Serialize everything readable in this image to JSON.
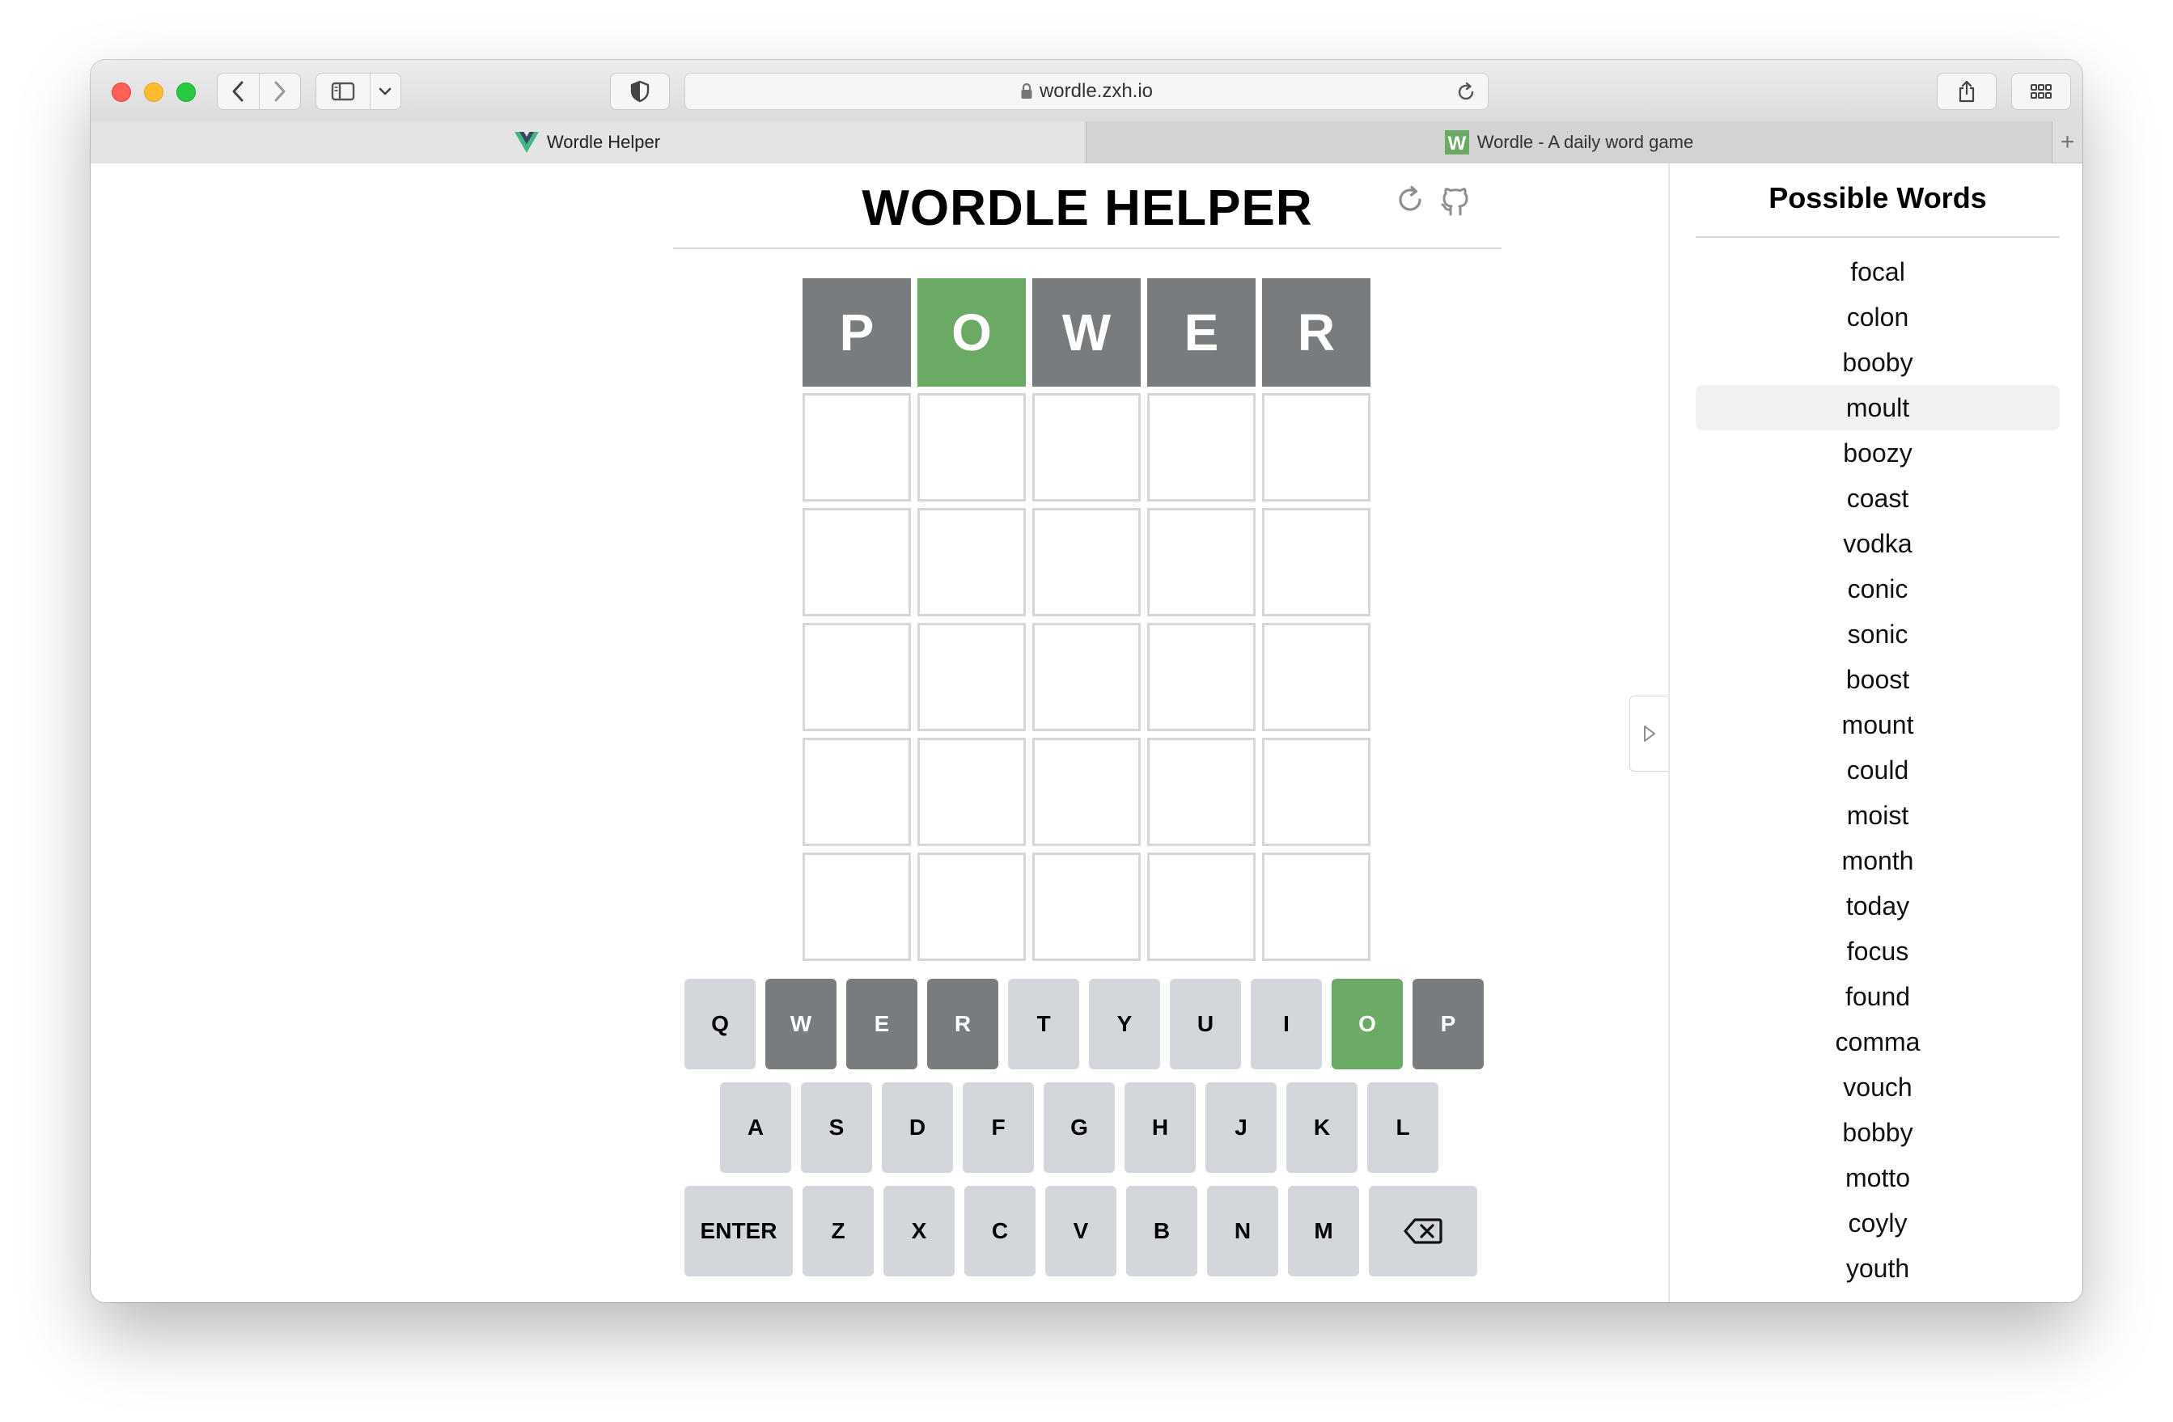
{
  "browser": {
    "url": "wordle.zxh.io",
    "tabs": [
      {
        "label": "Wordle Helper",
        "active": true,
        "icon": "vue-logo-icon"
      },
      {
        "label": "Wordle - A daily word game",
        "active": false,
        "icon": "wordle-w-icon"
      }
    ],
    "new_tab_label": "+"
  },
  "app": {
    "title": "WORDLE HELPER",
    "header_icons": [
      "refresh-icon",
      "github-icon"
    ]
  },
  "board": {
    "rows": [
      [
        {
          "letter": "P",
          "state": "absent"
        },
        {
          "letter": "O",
          "state": "correct"
        },
        {
          "letter": "W",
          "state": "absent"
        },
        {
          "letter": "E",
          "state": "absent"
        },
        {
          "letter": "R",
          "state": "absent"
        }
      ],
      [
        {
          "letter": "",
          "state": "empty"
        },
        {
          "letter": "",
          "state": "empty"
        },
        {
          "letter": "",
          "state": "empty"
        },
        {
          "letter": "",
          "state": "empty"
        },
        {
          "letter": "",
          "state": "empty"
        }
      ],
      [
        {
          "letter": "",
          "state": "empty"
        },
        {
          "letter": "",
          "state": "empty"
        },
        {
          "letter": "",
          "state": "empty"
        },
        {
          "letter": "",
          "state": "empty"
        },
        {
          "letter": "",
          "state": "empty"
        }
      ],
      [
        {
          "letter": "",
          "state": "empty"
        },
        {
          "letter": "",
          "state": "empty"
        },
        {
          "letter": "",
          "state": "empty"
        },
        {
          "letter": "",
          "state": "empty"
        },
        {
          "letter": "",
          "state": "empty"
        }
      ],
      [
        {
          "letter": "",
          "state": "empty"
        },
        {
          "letter": "",
          "state": "empty"
        },
        {
          "letter": "",
          "state": "empty"
        },
        {
          "letter": "",
          "state": "empty"
        },
        {
          "letter": "",
          "state": "empty"
        }
      ],
      [
        {
          "letter": "",
          "state": "empty"
        },
        {
          "letter": "",
          "state": "empty"
        },
        {
          "letter": "",
          "state": "empty"
        },
        {
          "letter": "",
          "state": "empty"
        },
        {
          "letter": "",
          "state": "empty"
        }
      ]
    ]
  },
  "keyboard": {
    "rows": [
      [
        {
          "label": "Q",
          "state": "unused"
        },
        {
          "label": "W",
          "state": "absent"
        },
        {
          "label": "E",
          "state": "absent"
        },
        {
          "label": "R",
          "state": "absent"
        },
        {
          "label": "T",
          "state": "unused"
        },
        {
          "label": "Y",
          "state": "unused"
        },
        {
          "label": "U",
          "state": "unused"
        },
        {
          "label": "I",
          "state": "unused"
        },
        {
          "label": "O",
          "state": "correct"
        },
        {
          "label": "P",
          "state": "absent"
        }
      ],
      [
        {
          "label": "A",
          "state": "unused"
        },
        {
          "label": "S",
          "state": "unused"
        },
        {
          "label": "D",
          "state": "unused"
        },
        {
          "label": "F",
          "state": "unused"
        },
        {
          "label": "G",
          "state": "unused"
        },
        {
          "label": "H",
          "state": "unused"
        },
        {
          "label": "J",
          "state": "unused"
        },
        {
          "label": "K",
          "state": "unused"
        },
        {
          "label": "L",
          "state": "unused"
        }
      ],
      [
        {
          "label": "ENTER",
          "state": "unused",
          "wide": true
        },
        {
          "label": "Z",
          "state": "unused"
        },
        {
          "label": "X",
          "state": "unused"
        },
        {
          "label": "C",
          "state": "unused"
        },
        {
          "label": "V",
          "state": "unused"
        },
        {
          "label": "B",
          "state": "unused"
        },
        {
          "label": "N",
          "state": "unused"
        },
        {
          "label": "M",
          "state": "unused"
        },
        {
          "label": "",
          "state": "unused",
          "wide": true,
          "icon": "backspace-icon"
        }
      ]
    ]
  },
  "sidebar": {
    "title": "Possible Words",
    "highlighted_index": 3,
    "words": [
      "focal",
      "colon",
      "booby",
      "moult",
      "boozy",
      "coast",
      "vodka",
      "conic",
      "sonic",
      "boost",
      "mount",
      "could",
      "moist",
      "month",
      "today",
      "focus",
      "found",
      "comma",
      "vouch",
      "bobby",
      "motto",
      "coyly",
      "youth"
    ]
  },
  "colors": {
    "correct": "#6aaa64",
    "absent": "#787c7e",
    "unused_key": "#d3d6da",
    "tile_border": "#d3d6da"
  }
}
